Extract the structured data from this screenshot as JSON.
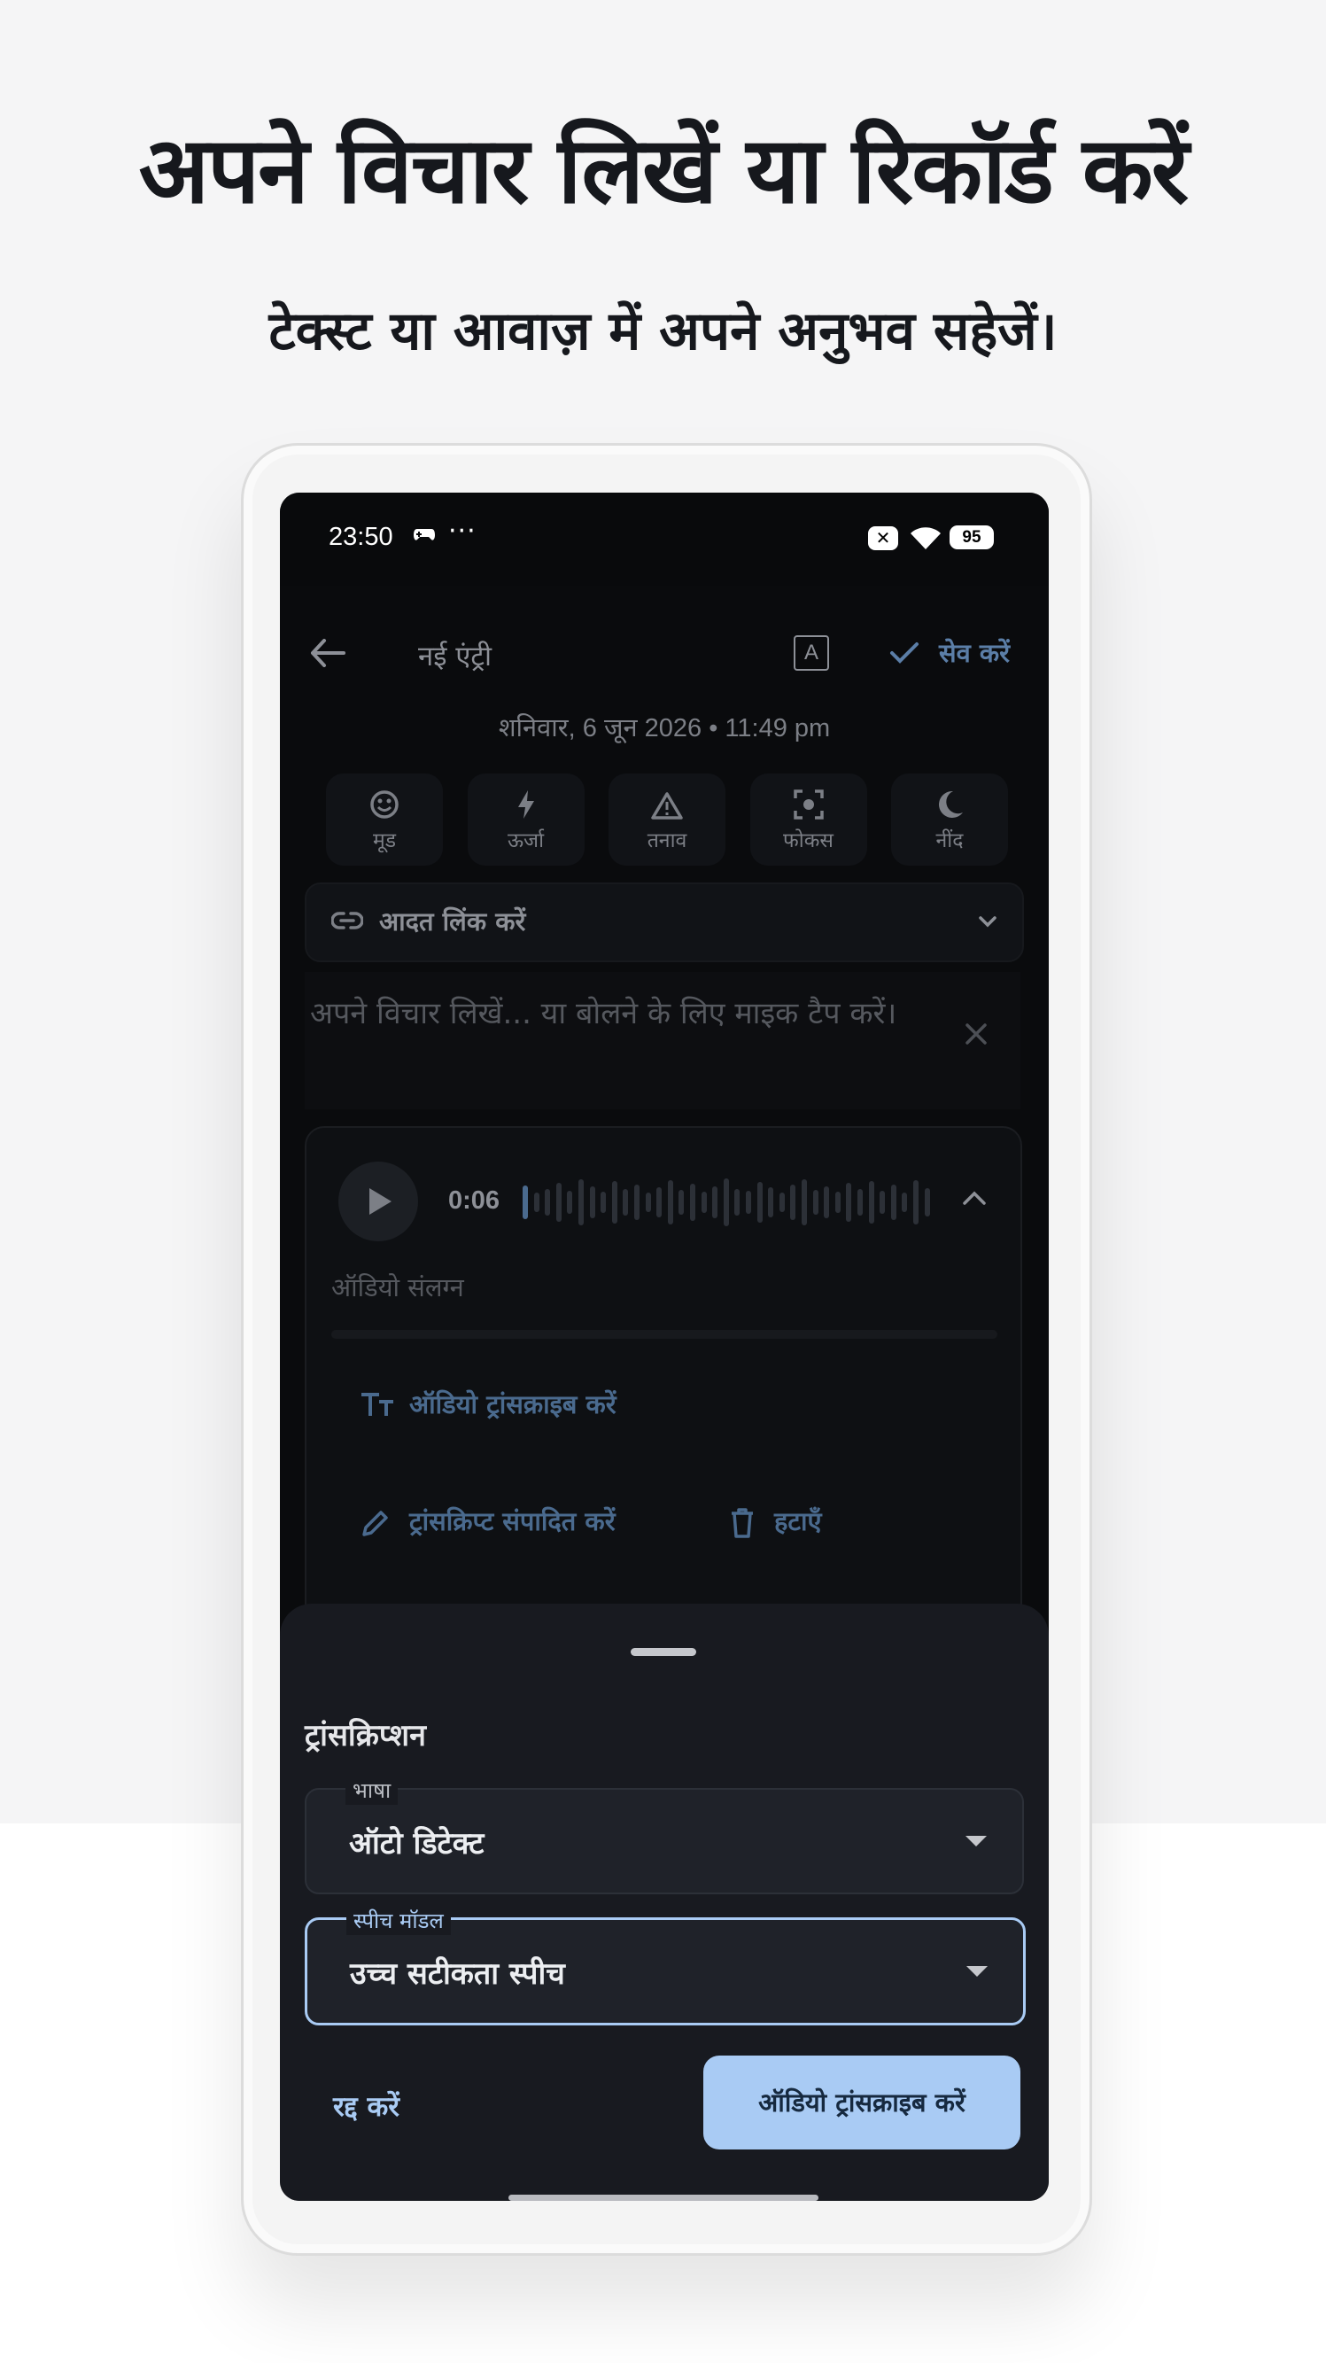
{
  "promo": {
    "headline": "अपने विचार लिखें या रिकॉर्ड करें",
    "subline": "टेक्स्ट या आवाज़ में अपने अनुभव सहेजें।"
  },
  "status_bar": {
    "time": "23:50",
    "dots": "···",
    "battery": "95"
  },
  "toolbar": {
    "title": "नई एंट्री",
    "format_glyph": "A",
    "save_label": "सेव करें"
  },
  "entry": {
    "date": "शनिवार, 6 जून 2026 • 11:49 pm",
    "metrics": [
      {
        "label": "मूड",
        "icon": "smile-icon"
      },
      {
        "label": "ऊर्जा",
        "icon": "bolt-icon"
      },
      {
        "label": "तनाव",
        "icon": "warning-icon"
      },
      {
        "label": "फोकस",
        "icon": "focus-icon"
      },
      {
        "label": "नींद",
        "icon": "moon-icon"
      }
    ],
    "habit_link_label": "आदत लिंक करें",
    "note_placeholder": "अपने विचार लिखें... या बोलने के लिए माइक टैप करें।"
  },
  "audio": {
    "duration": "0:06",
    "attached_label": "ऑडियो संलग्न",
    "transcribe_label": "ऑडियो ट्रांसक्राइब करें",
    "edit_transcript_label": "ट्रांसक्रिप्ट संपादित करें",
    "remove_label": "हटाएँ"
  },
  "sheet": {
    "title": "ट्रांसक्रिप्शन",
    "language_label": "भाषा",
    "language_value": "ऑटो डिटेक्ट",
    "model_label": "स्पीच मॉडल",
    "model_value": "उच्च सटीकता स्पीच",
    "cancel_label": "रद्द करें",
    "confirm_label": "ऑडियो ट्रांसक्राइब करें"
  },
  "colors": {
    "accent": "#a9cbf4",
    "sheet_bg": "#181a20",
    "screen_bg": "#0a0b0d"
  }
}
